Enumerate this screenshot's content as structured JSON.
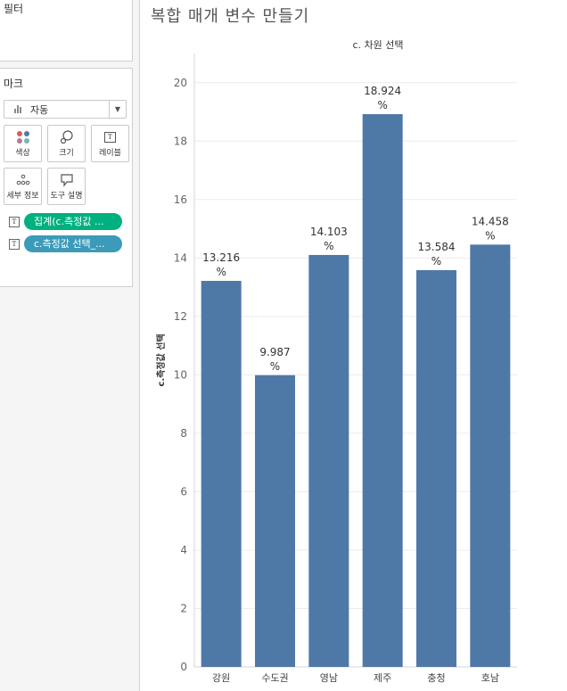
{
  "filters": {
    "title": "필터"
  },
  "marks": {
    "title": "마크",
    "mark_type": "자동",
    "buttons": {
      "color": "색상",
      "size": "크기",
      "label": "레이블",
      "detail": "세부 정보",
      "tooltip": "도구 설명"
    },
    "pills": [
      {
        "text": "집계(c.측정값 ...",
        "color": "#00b180"
      },
      {
        "text": "c.측정값 선택_...",
        "color": "#3b9bb9"
      }
    ]
  },
  "sheet": {
    "title": "복합 매개 변수 만들기"
  },
  "chart_data": {
    "type": "bar",
    "title": "c. 차원 선택",
    "xlabel": "",
    "ylabel": "c.측정값 선택",
    "categories": [
      "강원",
      "수도권",
      "영남",
      "제주",
      "충청",
      "호남"
    ],
    "values": [
      13.216,
      9.987,
      14.103,
      18.924,
      13.584,
      14.458
    ],
    "data_labels": [
      [
        "13.216",
        "%"
      ],
      [
        "9.987",
        "%"
      ],
      [
        "14.103",
        "%"
      ],
      [
        "18.924",
        "%"
      ],
      [
        "13.584",
        "%"
      ],
      [
        "14.458",
        "%"
      ]
    ],
    "ylim": [
      0,
      21
    ],
    "yticks": [
      0,
      2,
      4,
      6,
      8,
      10,
      12,
      14,
      16,
      18,
      20
    ],
    "bar_color": "#4e79a7",
    "grid": true
  }
}
